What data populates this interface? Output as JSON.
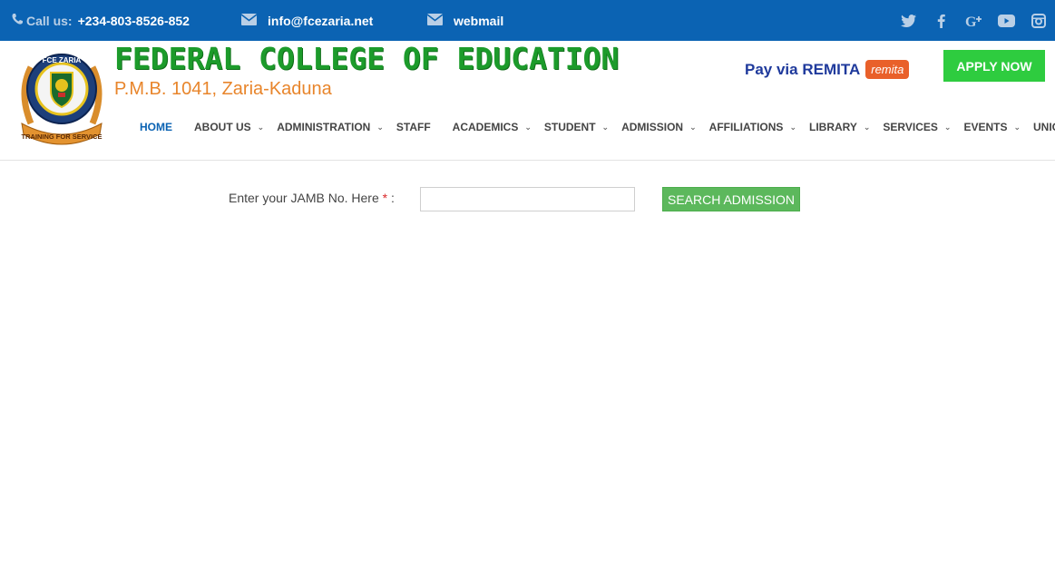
{
  "topbar": {
    "call_label": "Call us:",
    "phone": "+234-803-8526-852",
    "email": "info@fcezaria.net",
    "webmail": "webmail",
    "socials": [
      "twitter-icon",
      "facebook-icon",
      "google-plus-icon",
      "youtube-icon",
      "instagram-icon"
    ]
  },
  "header": {
    "college_name": "FEDERAL COLLEGE OF EDUCATION",
    "address": "P.M.B. 1041, Zaria-Kaduna",
    "logo_text_top": "FCE ZARIA",
    "logo_text_bottom": "TRAINING FOR SERVICE",
    "remita_text": "Pay via REMITA",
    "remita_badge": "remita",
    "apply_label": "APPLY NOW"
  },
  "nav": {
    "items": [
      {
        "label": "HOME",
        "dropdown": false
      },
      {
        "label": "ABOUT US",
        "dropdown": true
      },
      {
        "label": "ADMINISTRATION",
        "dropdown": true
      },
      {
        "label": "STAFF",
        "dropdown": false
      },
      {
        "label": "ACADEMICS",
        "dropdown": true
      },
      {
        "label": "STUDENT",
        "dropdown": true
      },
      {
        "label": "ADMISSION",
        "dropdown": true
      },
      {
        "label": "AFFILIATIONS",
        "dropdown": true
      },
      {
        "label": "LIBRARY",
        "dropdown": true
      },
      {
        "label": "SERVICES",
        "dropdown": true
      },
      {
        "label": "EVENTS",
        "dropdown": true
      },
      {
        "label": "UNIONS",
        "dropdown": true
      }
    ]
  },
  "form": {
    "label": "Enter your JAMB No. Here",
    "required_mark": "*",
    "colon": ":",
    "input_value": "",
    "button_label": "SEARCH ADMISSION"
  },
  "colors": {
    "topbar": "#0b63b3",
    "college_green": "#1c9b2b",
    "address_orange": "#e8852b",
    "apply_green": "#2ecc3f",
    "search_green": "#5cb85c"
  }
}
